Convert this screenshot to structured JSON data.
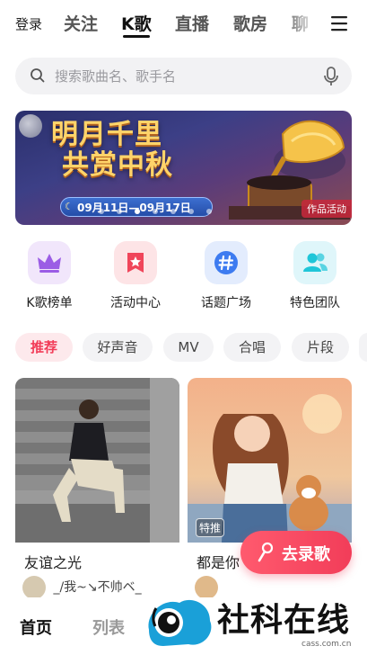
{
  "topnav": {
    "login": "登录",
    "tabs": [
      {
        "label": "关注",
        "active": false
      },
      {
        "label": "K歌",
        "active": true
      },
      {
        "label": "直播",
        "active": false
      },
      {
        "label": "歌房",
        "active": false
      },
      {
        "label": "聊",
        "active": false
      }
    ],
    "menu_icon": "hamburger-menu-icon"
  },
  "search": {
    "placeholder": "搜索歌曲名、歌手名",
    "icon": "search-icon",
    "mic_icon": "microphone-icon"
  },
  "banner": {
    "title_line1": "明月千里",
    "title_line2": "共赏中秋",
    "date": "09月11日—09月17日",
    "tag": "作品活动",
    "active_dot": 2,
    "dot_count": 7
  },
  "categories": [
    {
      "label": "K歌榜单",
      "icon": "crown-icon",
      "color": "#9b5de5"
    },
    {
      "label": "活动中心",
      "icon": "star-flag-icon",
      "color": "#f0455a"
    },
    {
      "label": "话题广场",
      "icon": "hashtag-icon",
      "color": "#3d7bf0"
    },
    {
      "label": "特色团队",
      "icon": "people-icon",
      "color": "#1fc6d8"
    }
  ],
  "filters": [
    {
      "label": "推荐",
      "active": true
    },
    {
      "label": "好声音",
      "active": false
    },
    {
      "label": "MV",
      "active": false
    },
    {
      "label": "合唱",
      "active": false
    },
    {
      "label": "片段",
      "active": false
    }
  ],
  "cards": [
    {
      "title": "友谊之光",
      "user": "_/我~↘不帅ベ_",
      "tag": ""
    },
    {
      "title": "都是你",
      "user": "",
      "tag": "特推"
    }
  ],
  "record_button": {
    "label": "去录歌",
    "icon": "microphone-icon"
  },
  "bottom_nav": {
    "home": "首页",
    "list": "列表"
  },
  "watermark": {
    "text": "社科在线",
    "url": "cass.com.cn"
  },
  "colors": {
    "accent": "#f23d59",
    "chip_bg": "#f3f3f5"
  }
}
